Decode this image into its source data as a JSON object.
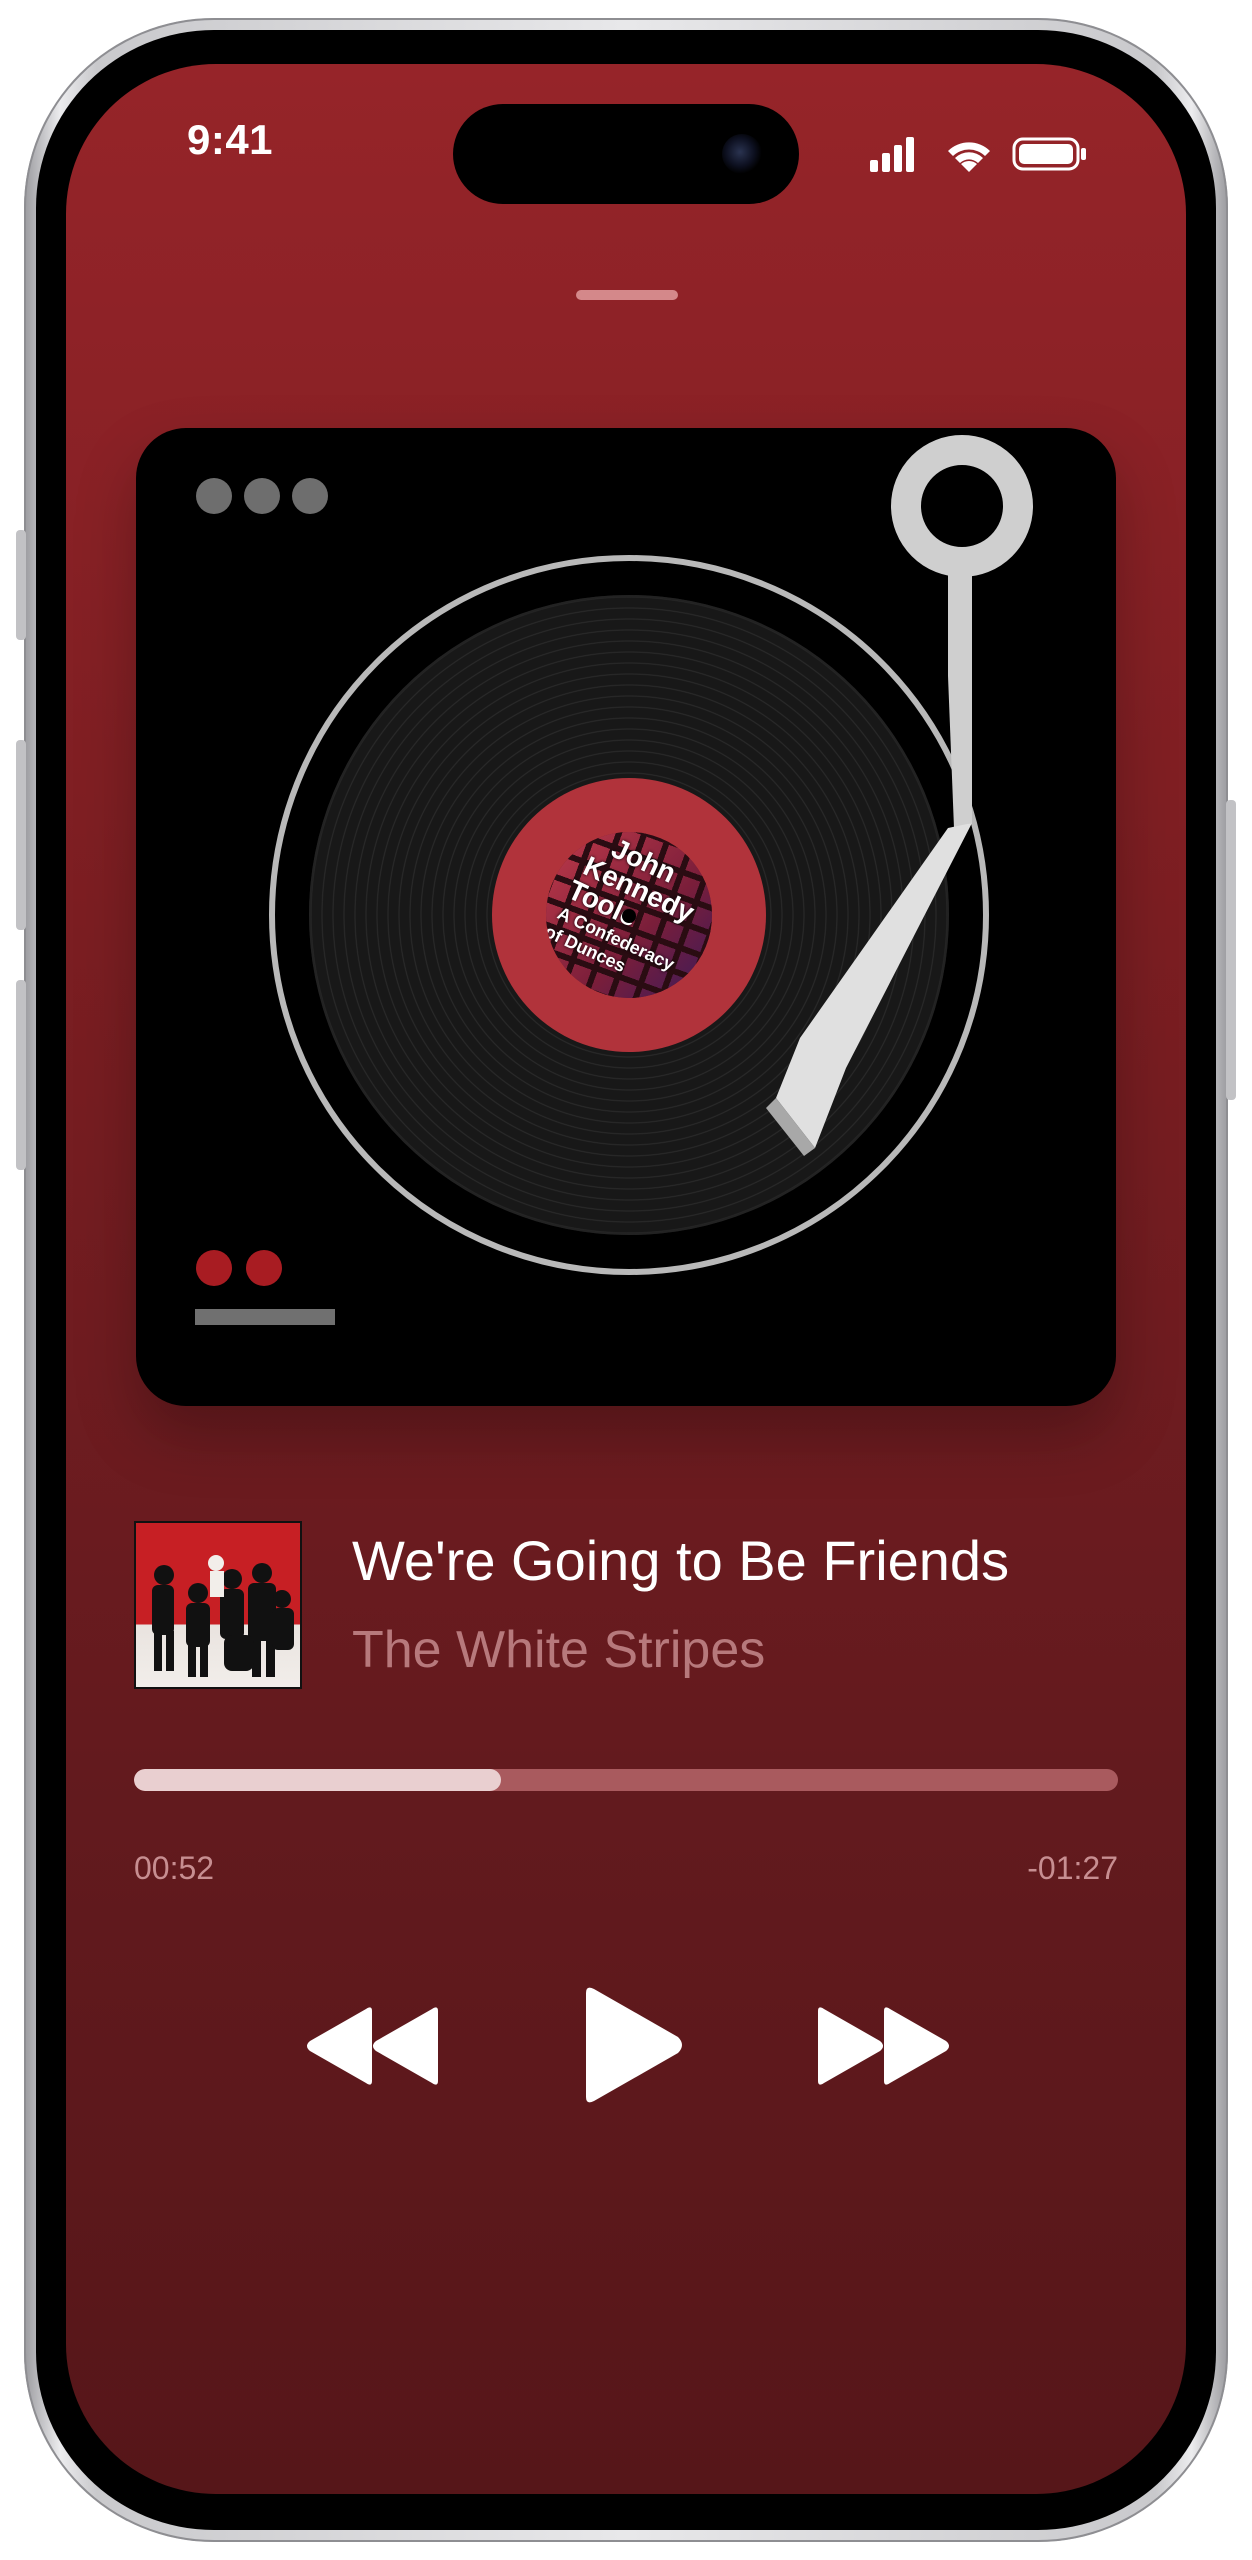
{
  "status_bar": {
    "time": "9:41",
    "icons": [
      "cellular-signal-icon",
      "wifi-icon",
      "battery-icon"
    ]
  },
  "vinyl_card": {
    "menu_icon": "ellipsis-icon",
    "record_label_lines": [
      "John",
      "Kennedy",
      "Toole",
      "A Confederacy",
      "of Dunces"
    ],
    "accent_color": "#a81c22"
  },
  "now_playing": {
    "title": "We're Going to Be Friends",
    "artist": "The White Stripes",
    "elapsed": "00:52",
    "remaining": "-01:27",
    "progress": 0.373
  },
  "controls": {
    "icons": [
      "rewind-icon",
      "play-icon",
      "fast-forward-icon"
    ]
  },
  "colors": {
    "background_top": "#962429",
    "background_bottom": "#561619",
    "progress_fill": "#e9cfd0",
    "progress_track": "#a95a5e"
  }
}
